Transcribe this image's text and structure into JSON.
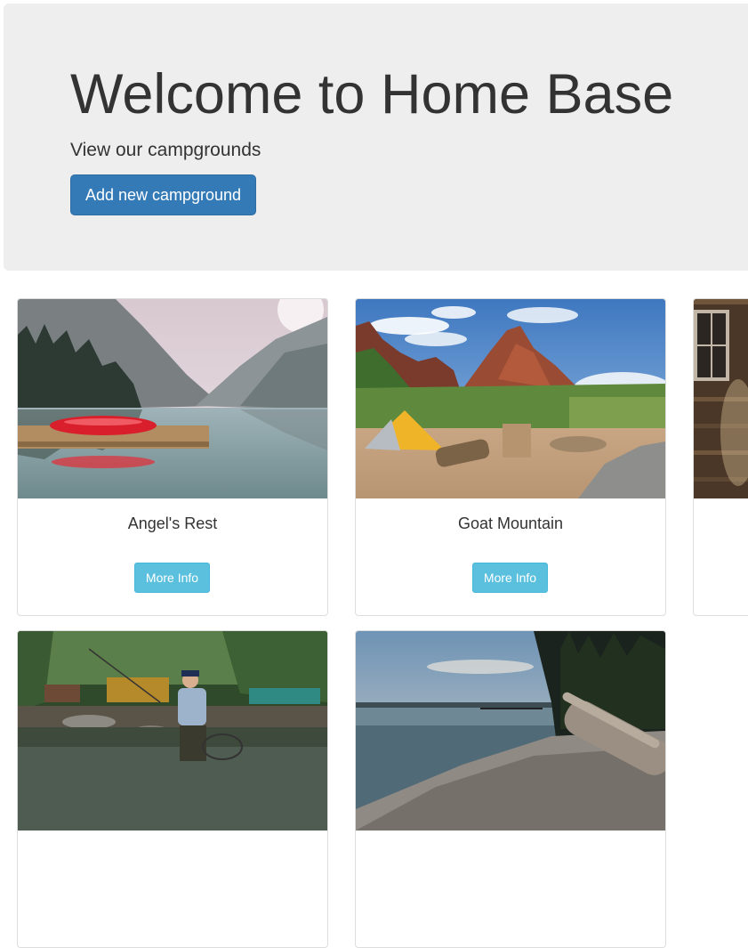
{
  "jumbotron": {
    "title": "Welcome to Home Base",
    "subtitle": "View our campgrounds",
    "add_button_label": "Add new campground"
  },
  "campgrounds": [
    {
      "name": "Angel's Rest",
      "button_label": "More Info",
      "image": "lake-with-red-kayak-on-dock"
    },
    {
      "name": "Goat Mountain",
      "button_label": "More Info",
      "image": "desert-campsite-with-tent-and-red-peak"
    },
    {
      "name": "",
      "button_label": "",
      "image": "wooden-cabin-wall-with-window"
    },
    {
      "name": "",
      "button_label": "",
      "image": "angler-fly-fishing-in-river"
    },
    {
      "name": "",
      "button_label": "",
      "image": "rocky-lakeshore-with-driftwood"
    }
  ],
  "colors": {
    "jumbotron_bg": "#eeeeee",
    "primary": "#337ab7",
    "info": "#5bc0de",
    "text": "#333333"
  }
}
